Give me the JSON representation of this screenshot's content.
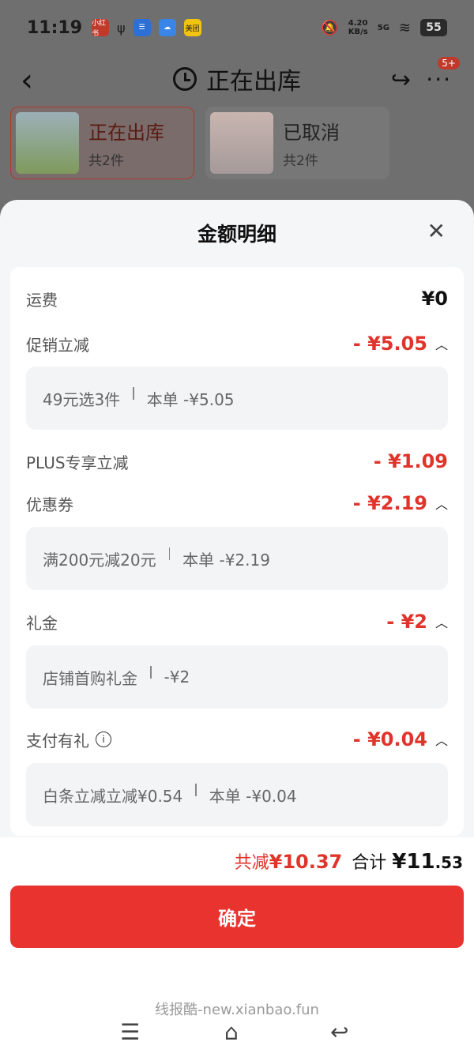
{
  "status": {
    "time": "11:19",
    "speed": "4.20\nKB/s",
    "network": "5G",
    "battery": "55",
    "app1": "小红书",
    "app2": "美团"
  },
  "nav": {
    "title": "正在出库",
    "badge": "5+"
  },
  "orders": [
    {
      "title": "正在出库",
      "count": "共2件"
    },
    {
      "title": "已取消",
      "count": "共2件"
    }
  ],
  "sheet": {
    "title": "金额明细",
    "rows": {
      "shipping": {
        "label": "运费",
        "value": "¥0"
      },
      "promo": {
        "label": "促销立减",
        "value": "- ¥5.05",
        "detail_name": "49元选3件",
        "detail_value": "本单 -¥5.05"
      },
      "plus": {
        "label": "PLUS专享立减",
        "value": "- ¥1.09"
      },
      "coupon": {
        "label": "优惠券",
        "value": "- ¥2.19",
        "detail_name": "满200元减20元",
        "detail_value": "本单 -¥2.19"
      },
      "gift": {
        "label": "礼金",
        "value": "- ¥2",
        "detail_name": "店铺首购礼金",
        "detail_value": "-¥2"
      },
      "pay": {
        "label": "支付有礼",
        "value": "- ¥0.04",
        "detail_name": "白条立减立减¥0.54",
        "detail_value": "本单 -¥0.04"
      }
    }
  },
  "footer": {
    "saved_label": "共减",
    "saved_value": "¥10.37",
    "total_label": "合计",
    "total_currency": "¥",
    "total_int": "11",
    "total_dec": ".53",
    "confirm": "确定",
    "watermark": "线报酷-new.xianbao.fun"
  },
  "colors": {
    "accent": "#e8332f",
    "discount": "#e0342b"
  }
}
